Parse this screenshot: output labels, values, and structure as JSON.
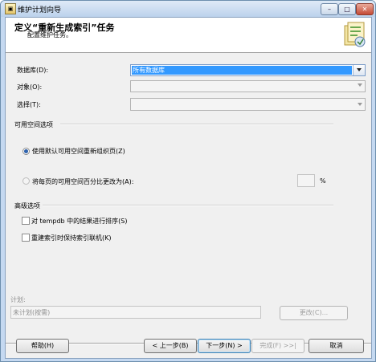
{
  "window": {
    "title": "维护计划向导",
    "controls": {
      "minimize": "–",
      "maximize": "□",
      "close": "✕"
    }
  },
  "header": {
    "title": "定义“重新生成索引”任务",
    "subtitle": "配置维护任务。",
    "art_icon": "wizard-task-icon"
  },
  "form": {
    "database": {
      "label": "数据库(D):",
      "value": "所有数据库"
    },
    "object": {
      "label": "对象(O):",
      "value": ""
    },
    "selection": {
      "label": "选择(T):",
      "value": ""
    }
  },
  "free_space": {
    "group_label": "可用空间选项",
    "option_default": {
      "label": "使用默认可用空间重新组织页(Z)",
      "selected": true
    },
    "option_percent": {
      "label": "将每页的可用空间百分比更改为(A):",
      "selected": false,
      "value": "",
      "unit": "%"
    }
  },
  "advanced": {
    "group_label": "高级选项",
    "sort_tempdb": {
      "label": "对 tempdb 中的结果进行排序(S)",
      "checked": false
    },
    "keep_online": {
      "label": "重建索引时保持索引联机(K)",
      "checked": false
    }
  },
  "schedule": {
    "label": "计划:",
    "value": "未计划(按需)",
    "change_button": "更改(C)..."
  },
  "footer": {
    "help": "帮助(H)",
    "back": "< 上一步(B)",
    "next": "下一步(N) >",
    "finish": "完成(F) >>|",
    "cancel": "取消"
  },
  "colors": {
    "selection": "#3399ff",
    "window_frame": "#c5d9f1",
    "dialog_background": "#f0f0f0"
  }
}
